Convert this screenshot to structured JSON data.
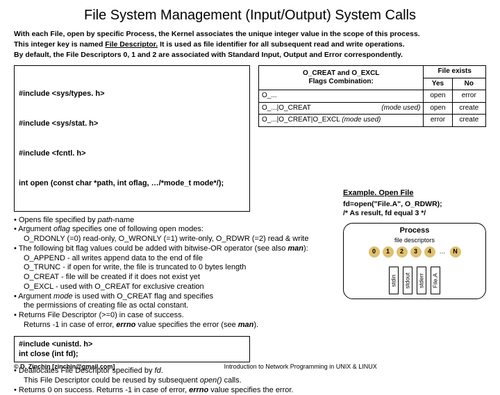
{
  "title": "File System Management (Input/Output) System Calls",
  "intro": {
    "l1": "With each File, open by specific Process, the Kernel associates the unique integer value in the scope of this process.",
    "l2a": "This integer key is named ",
    "l2b": "File Descriptor.",
    "l2c": " It is used as file identifier for all subsequent read and write operations.",
    "l3": "By default, the File Descriptors 0, 1 and 2 are associated with Standard Input, Output and Error correspondently."
  },
  "code_open": {
    "l1": "#include <sys/types. h>",
    "l2": "#include <sys/stat. h>",
    "l3": "#include <fcntl. h>",
    "l4": "int open (const char *path, int oflag, …/*mode_t mode*/);"
  },
  "flags_table": {
    "h1": "O_CREAT and O_EXCL\nFlags Combination:",
    "h2": "File exists",
    "yes": "Yes",
    "no": "No",
    "r1c1": "O_...",
    "r1c2": "open",
    "r1c3": "error",
    "r2c1a": "O_...|O_CREAT",
    "r2c1b": "(mode used)",
    "r2c2": "open",
    "r2c3": "create",
    "r3c1a": "O_...|O_CREAT|O_EXCL ",
    "r3c1b": "(mode used)",
    "r3c2": "error",
    "r3c3": "create"
  },
  "body": {
    "b1a": "• Opens file specified by ",
    "b1b": "path",
    "b1c": "-name",
    "b2a": "• Argument ",
    "b2b": "oflag",
    "b2c": " specifies one of following open modes:",
    "b3": "O_RDONLY  (=0) read-only, O_WRONLY (=1) write-only, O_RDWR (=2) read & write",
    "b4a": "• The following bit flag values could be added with bitwise-OR operator (see also ",
    "b4b": "man",
    "b4c": "):",
    "b5": "O_APPEND - all writes append data to the end of file",
    "b6": "O_TRUNC    - if open for write, the file is truncated to 0 bytes length",
    "b7": "O_CREAT   - file will be created if it does not exist yet",
    "b8": "O_EXCL      - used with O_CREAT for exclusive creation",
    "b9a": "• Argument ",
    "b9b": "mode",
    "b9c": " is used with O_CREAT flag and specifies",
    "b10": "the permissions of creating file as octal constant.",
    "b11": "• Returns File Descriptor (>=0) in case of success.",
    "b12a": "Returns -1 in case of error, ",
    "b12b": "errno",
    "b12c": " value specifies the error (see ",
    "b12d": "man",
    "b12e": ")."
  },
  "example": {
    "title": "Example. Open File",
    "l1": "fd=open(\"File.A\", O_RDWR);",
    "l2": "/* As result, fd equal 3 */"
  },
  "process": {
    "title": "Process",
    "sub": "file descriptors",
    "d0": "0",
    "d1": "1",
    "d2": "2",
    "d3": "3",
    "d4": "4",
    "dN": "N",
    "ell": "…",
    "s0": "stdin",
    "s1": "stdout",
    "s2": "stderr",
    "s3": "File.A"
  },
  "code_close": {
    "l1": "#include <unistd. h>",
    "l2": "int close (int fd);"
  },
  "bottom": {
    "l1a": "• Deallocates File Descriptor specified by ",
    "l1b": "fd",
    "l1c": ".",
    "l2a": "This File Descriptor could be reused by subsequent ",
    "l2b": "open()",
    "l2c": " calls.",
    "l3a": "• Returns 0 on success. Returns -1 in case of error, ",
    "l3b": "errno",
    "l3c": " value specifies the error."
  },
  "footer": {
    "copyright": "© D. Zinchin [zinchin@gmail.com]",
    "center": "Introduction to Network Programming in UNIX & LINUX"
  }
}
